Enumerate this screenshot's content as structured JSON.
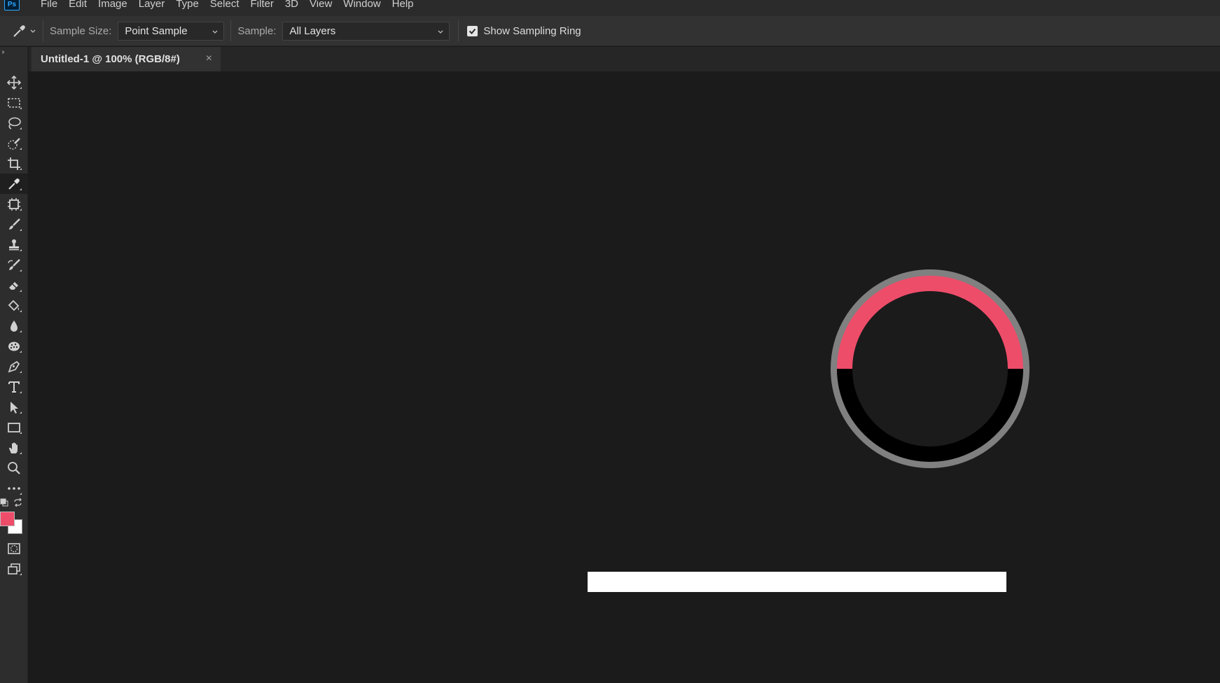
{
  "app": {
    "logo_text": "Ps",
    "menu": [
      "File",
      "Edit",
      "Image",
      "Layer",
      "Type",
      "Select",
      "Filter",
      "3D",
      "View",
      "Window",
      "Help"
    ]
  },
  "options": {
    "tool_icon": "eyedropper-icon",
    "sample_size_label": "Sample Size:",
    "sample_size_value": "Point Sample",
    "sample_label": "Sample:",
    "sample_value": "All Layers",
    "show_ring_checked": true,
    "show_ring_label": "Show Sampling Ring"
  },
  "toolbar": {
    "tools": [
      {
        "name": "move-tool",
        "icon": "move-icon"
      },
      {
        "name": "marquee-tool",
        "icon": "rectangular-marquee-icon"
      },
      {
        "name": "lasso-tool",
        "icon": "lasso-icon"
      },
      {
        "name": "quick-selection-tool",
        "icon": "quick-selection-icon"
      },
      {
        "name": "crop-tool",
        "icon": "crop-icon"
      },
      {
        "name": "eyedropper-tool",
        "icon": "eyedropper-icon",
        "active": true
      },
      {
        "name": "frame-tool",
        "icon": "frame-icon"
      },
      {
        "name": "brush-tool",
        "icon": "brush-icon"
      },
      {
        "name": "clone-stamp-tool",
        "icon": "stamp-icon"
      },
      {
        "name": "history-brush-tool",
        "icon": "history-brush-icon"
      },
      {
        "name": "eraser-tool",
        "icon": "eraser-icon"
      },
      {
        "name": "paint-bucket-tool",
        "icon": "paint-bucket-icon"
      },
      {
        "name": "blur-tool",
        "icon": "drop-icon"
      },
      {
        "name": "dodge-tool",
        "icon": "sponge-icon"
      },
      {
        "name": "pen-tool",
        "icon": "pen-icon"
      },
      {
        "name": "type-tool",
        "icon": "type-icon"
      },
      {
        "name": "path-selection-tool",
        "icon": "arrow-icon"
      },
      {
        "name": "rectangle-tool",
        "icon": "rectangle-icon"
      },
      {
        "name": "hand-tool",
        "icon": "hand-icon"
      },
      {
        "name": "zoom-tool",
        "icon": "zoom-icon"
      },
      {
        "name": "edit-toolbar",
        "icon": "more-icon"
      }
    ],
    "foreground_color": "#ee4d6a",
    "background_color": "#ffffff"
  },
  "document": {
    "tab_title": "Untitled-1 @ 100% (RGB/8#)",
    "close_glyph": "×"
  },
  "sampling_ring": {
    "current_color": "#ee4d6a",
    "previous_color": "#000000",
    "outer_ring_color": "#808080"
  },
  "colors": {
    "app_bg": "#1b1b1b",
    "panel_bg": "#323232",
    "accent": "#31a8ff"
  }
}
